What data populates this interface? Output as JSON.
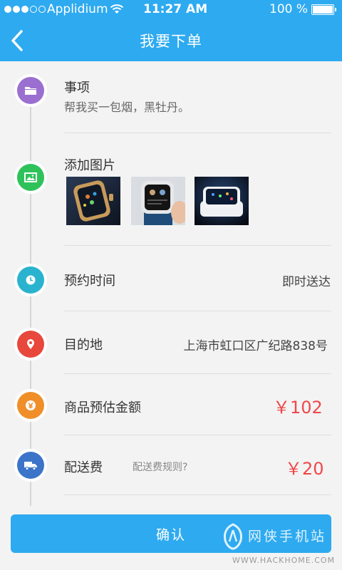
{
  "status_bar": {
    "carrier": "Applidium",
    "time": "11:27 AM",
    "battery": "100 %"
  },
  "nav": {
    "title": "我要下单",
    "back_icon": "chevron-left-icon"
  },
  "rows": {
    "item": {
      "label": "事项",
      "value": "帮我买一包烟，黑牡丹。",
      "icon": "folder-icon",
      "color": "#9b6fd0"
    },
    "images": {
      "label": "添加图片",
      "icon": "image-icon",
      "color": "#2fc25b"
    },
    "time": {
      "label": "预约时间",
      "value": "即时送达",
      "icon": "clock-icon",
      "color": "#29b3cf"
    },
    "destination": {
      "label": "目的地",
      "value": "上海市虹口区广纪路838号",
      "icon": "location-pin-icon",
      "color": "#e8473c"
    },
    "estimate": {
      "label": "商品预估金额",
      "value": "￥102",
      "icon": "yen-icon",
      "color": "#f08f2a"
    },
    "fee": {
      "label": "配送费",
      "hint": "配送费规则?",
      "value": "￥20",
      "icon": "truck-icon",
      "color": "#3b74c9"
    }
  },
  "confirm_label": "确认",
  "watermark": {
    "name": "网侠手机站",
    "url": "WWW.HACKHOME.COM"
  }
}
